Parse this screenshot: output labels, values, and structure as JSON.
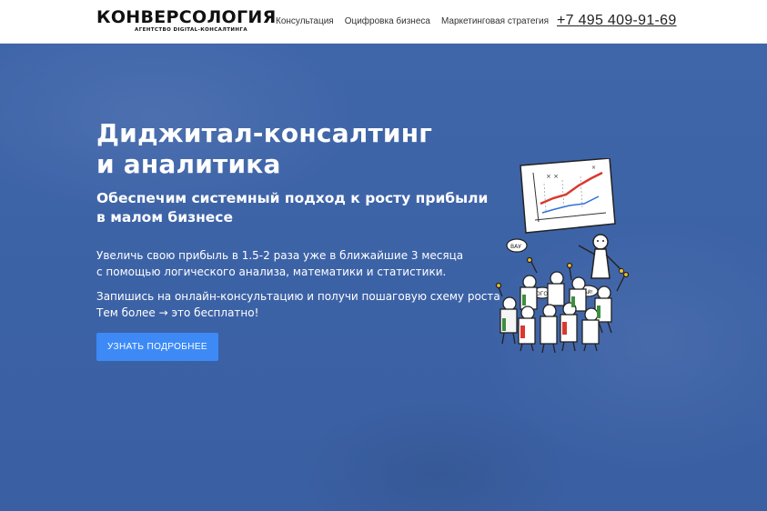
{
  "header": {
    "logo": {
      "name": "КОНВЕРСОЛОГИЯ",
      "tagline": "АГЕНТСТВО DIGITAL-КОНСАЛТИНГА"
    },
    "nav": [
      {
        "label": "Консультация"
      },
      {
        "label": "Оцифровка бизнеса"
      },
      {
        "label": "Маркетинговая стратегия"
      }
    ],
    "phone": "+7 495 409-91-69"
  },
  "hero": {
    "title_lines": [
      "Диджитал-консалтинг",
      "и аналитика"
    ],
    "subtitle_lines": [
      "Обеспечим системный подход к росту прибыли",
      "в малом бизнесе"
    ],
    "text1_lines": [
      "Увеличь свою прибыль в 1.5-2 раза уже в ближайшие 3 месяца",
      "с помощью логического анализа, математики и статистики."
    ],
    "text2_lines": [
      "Запишись на онлайн-консультацию и получи пошаговую схему роста",
      "Тем более → это бесплатно!"
    ],
    "cta_label": "УЗНАТЬ ПОДРОБНЕЕ",
    "illustration": {
      "icon": "crowd-with-chart-illustration",
      "sign_texts": [
        "ВАУ",
        "ОГО",
        "ВАЙ!"
      ]
    }
  },
  "colors": {
    "hero_bg": "#3e64a8",
    "cta": "#3d8af7",
    "header_bg": "#ffffff",
    "text_dark": "#222222"
  }
}
